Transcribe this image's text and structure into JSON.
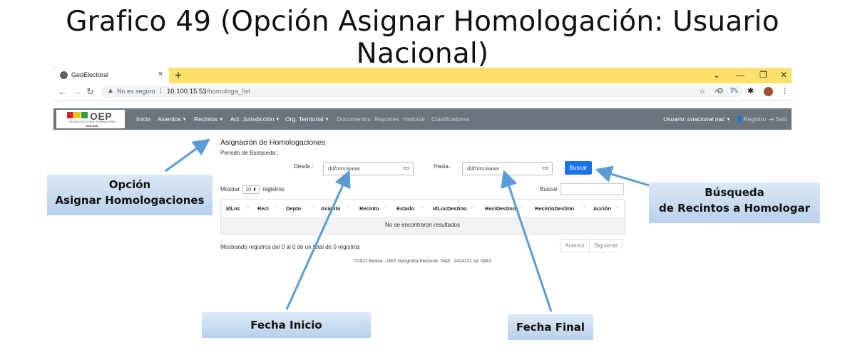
{
  "slide": {
    "title": "Grafico 49 (Opción Asignar Homologación: Usuario Nacional)"
  },
  "browser": {
    "tab_title": "GeoElectoral",
    "tab_close": "×",
    "new_tab": "+",
    "security_label": "No es seguro",
    "url_host": "10.100.15.53",
    "url_path": "/homologa_list",
    "tabbar_color": "#fde16b"
  },
  "app": {
    "logo_text": "OEP",
    "logo_subtitle": "ORGANO ELECTORAL PLURINACIONAL",
    "logo_country": "BOLIVIA",
    "nav": {
      "inicio": "Inicio",
      "asientos": "Asientos",
      "recintos": "Recintos",
      "act_jurisdiccion": "Act. Jurisdicción",
      "org_territorial": "Org. Territorial",
      "documentos": "Documentos",
      "reportes": "Reportes",
      "historial": "Historial",
      "clasificadores": "Clasificadores",
      "usuario": "Usuario: unacional nac",
      "registro": "Registro",
      "salir": "Salir"
    },
    "navbar_color": "#6c757d"
  },
  "page": {
    "heading": "Asignación de Homologaciones",
    "periodo_label": "Periodo de Busqueda.:",
    "desde_label": "Desde.:",
    "desde_placeholder": "dd/mm/aaaa",
    "hasta_label": "Hasta.:",
    "hasta_placeholder": "dd/mm/aaaa",
    "buscar_button": "Buscar",
    "mostrar_label": "Mostrar",
    "mostrar_value": "10",
    "registros_label": "registros",
    "search_label": "Buscar",
    "columns": [
      "IdLoc",
      "Reci",
      "Depto",
      "Asiento",
      "Recinto",
      "Estado",
      "IdLocDestino",
      "ReciDestino",
      "RecintoDestino",
      "Acción"
    ],
    "empty_message": "No se encontraron resultados",
    "showing_text": "Mostrando registros del 0 al 0 de un total de 0 registros",
    "prev_label": "Anterior",
    "next_label": "Siguiente",
    "footer": "©2021 Bolivia - OEP Geografía Electoral: Teléf.: 2424221 Int. 9943",
    "accent_color": "#1a73e8"
  },
  "callouts": {
    "opcion_line1": "Opción",
    "opcion_line2": "Asignar Homologaciones",
    "busqueda_line1": "Búsqueda",
    "busqueda_line2": "de Recintos a Homologar",
    "fecha_inicio": "Fecha Inicio",
    "fecha_final": "Fecha Final"
  }
}
